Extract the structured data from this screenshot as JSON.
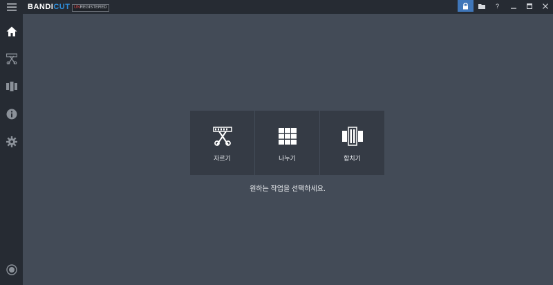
{
  "app": {
    "logo_part1": "BANDI",
    "logo_part2": "CUT",
    "badge_prefix": "UN",
    "badge_suffix": "REGISTERED",
    "accent": "#2f8fdc"
  },
  "window_controls": [
    {
      "name": "lock-icon",
      "label": "🔒"
    },
    {
      "name": "folder-icon",
      "label": "▬"
    },
    {
      "name": "help-icon",
      "label": "?"
    },
    {
      "name": "minimize-icon",
      "label": "_"
    },
    {
      "name": "maximize-icon",
      "label": "▭"
    },
    {
      "name": "close-icon",
      "label": "✕"
    }
  ],
  "sidebar": {
    "items": [
      "home-icon",
      "cut-icon",
      "split-icon",
      "info-icon",
      "settings-icon"
    ],
    "bottom": "record-icon"
  },
  "tiles": [
    {
      "label": "자르기",
      "icon": "cut-film-icon"
    },
    {
      "label": "나누기",
      "icon": "split-grid-icon"
    },
    {
      "label": "합치기",
      "icon": "join-film-icon"
    }
  ],
  "hint": "원하는 작업을 선택하세요."
}
